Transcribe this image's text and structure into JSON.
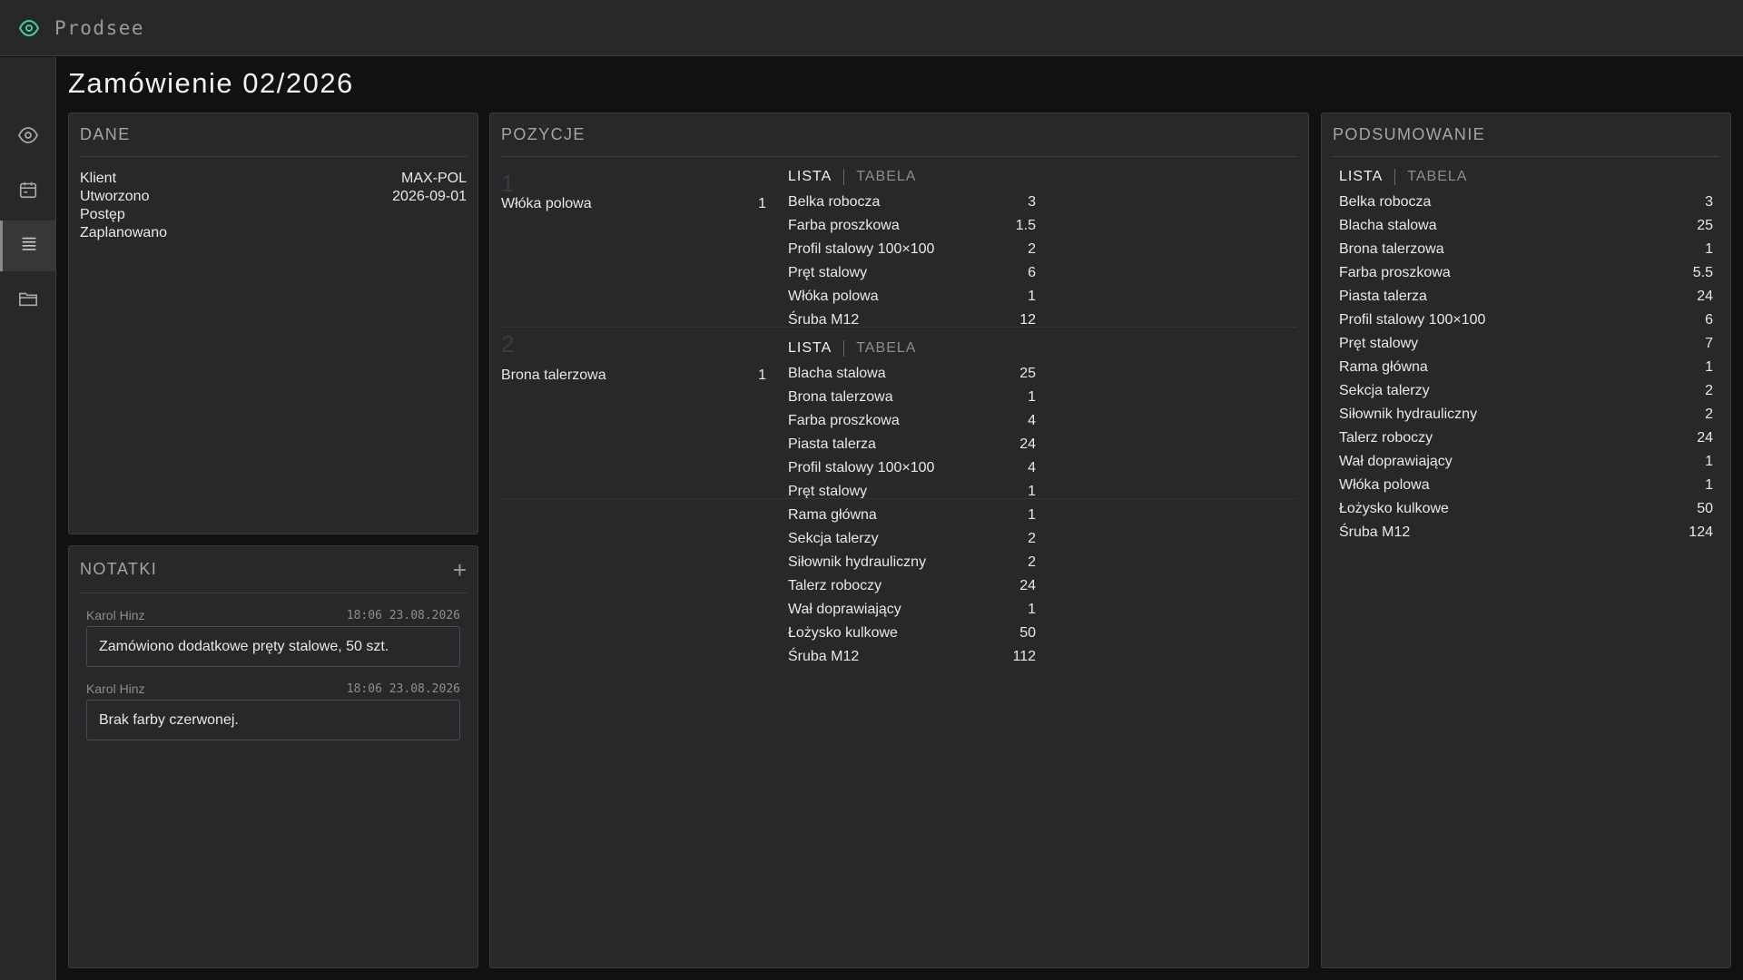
{
  "app": {
    "name": "Prodsee"
  },
  "page": {
    "title": "Zamówienie 02/2026"
  },
  "dane": {
    "title": "DANE",
    "fields": [
      {
        "label": "Klient",
        "value": "MAX-POL"
      },
      {
        "label": "Utworzono",
        "value": "2026-09-01"
      },
      {
        "label": "Postęp",
        "value": ""
      },
      {
        "label": "Zaplanowano",
        "value": ""
      }
    ]
  },
  "notatki": {
    "title": "NOTATKI",
    "add_label": "+",
    "notes": [
      {
        "author": "Karol Hinz",
        "time": "18:06 23.08.2026",
        "text": "Zamówiono dodatkowe pręty stalowe, 50 szt."
      },
      {
        "author": "Karol Hinz",
        "time": "18:06 23.08.2026",
        "text": "Brak farby czerwonej."
      }
    ]
  },
  "pozycje": {
    "title": "POZYCJE",
    "view_list": "LISTA",
    "view_table": "TABELA",
    "items": [
      {
        "number": "1",
        "name": "Włóka polowa",
        "qty": "1",
        "parts": [
          {
            "name": "Belka robocza",
            "qty": "3"
          },
          {
            "name": "Farba proszkowa",
            "qty": "1.5"
          },
          {
            "name": "Profil stalowy 100×100",
            "qty": "2"
          },
          {
            "name": "Pręt stalowy",
            "qty": "6"
          },
          {
            "name": "Włóka polowa",
            "qty": "1"
          },
          {
            "name": "Śruba M12",
            "qty": "12"
          }
        ]
      },
      {
        "number": "2",
        "name": "Brona talerzowa",
        "qty": "1",
        "parts": [
          {
            "name": "Blacha stalowa",
            "qty": "25"
          },
          {
            "name": "Brona talerzowa",
            "qty": "1"
          },
          {
            "name": "Farba proszkowa",
            "qty": "4"
          },
          {
            "name": "Piasta talerza",
            "qty": "24"
          },
          {
            "name": "Profil stalowy 100×100",
            "qty": "4"
          },
          {
            "name": "Pręt stalowy",
            "qty": "1"
          },
          {
            "name": "Rama główna",
            "qty": "1"
          },
          {
            "name": "Sekcja talerzy",
            "qty": "2"
          },
          {
            "name": "Siłownik hydrauliczny",
            "qty": "2"
          },
          {
            "name": "Talerz roboczy",
            "qty": "24"
          },
          {
            "name": "Wał doprawiający",
            "qty": "1"
          },
          {
            "name": "Łożysko kulkowe",
            "qty": "50"
          },
          {
            "name": "Śruba M12",
            "qty": "112"
          }
        ]
      }
    ]
  },
  "podsumowanie": {
    "title": "PODSUMOWANIE",
    "view_list": "LISTA",
    "view_table": "TABELA",
    "items": [
      {
        "name": "Belka robocza",
        "qty": "3"
      },
      {
        "name": "Blacha stalowa",
        "qty": "25"
      },
      {
        "name": "Brona talerzowa",
        "qty": "1"
      },
      {
        "name": "Farba proszkowa",
        "qty": "5.5"
      },
      {
        "name": "Piasta talerza",
        "qty": "24"
      },
      {
        "name": "Profil stalowy 100×100",
        "qty": "6"
      },
      {
        "name": "Pręt stalowy",
        "qty": "7"
      },
      {
        "name": "Rama główna",
        "qty": "1"
      },
      {
        "name": "Sekcja talerzy",
        "qty": "2"
      },
      {
        "name": "Siłownik hydrauliczny",
        "qty": "2"
      },
      {
        "name": "Talerz roboczy",
        "qty": "24"
      },
      {
        "name": "Wał doprawiający",
        "qty": "1"
      },
      {
        "name": "Włóka polowa",
        "qty": "1"
      },
      {
        "name": "Łożysko kulkowe",
        "qty": "50"
      },
      {
        "name": "Śruba M12",
        "qty": "124"
      }
    ]
  },
  "colors": {
    "accent": "#3fcfa0",
    "icon": "#a8a8a8",
    "panel": "#27282a",
    "background": "#111111"
  }
}
